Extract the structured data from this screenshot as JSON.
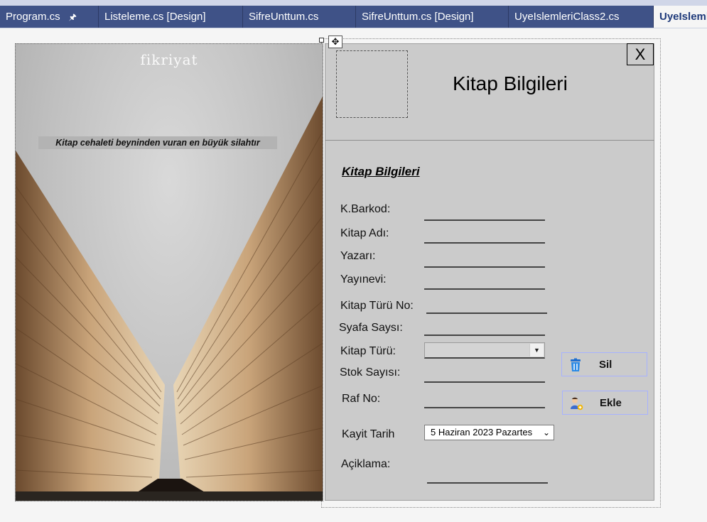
{
  "tabs": [
    {
      "label": "Program.cs",
      "pinned": true
    },
    {
      "label": "Listeleme.cs [Design]"
    },
    {
      "label": "SifreUnttum.cs"
    },
    {
      "label": "SifreUnttum.cs [Design]"
    },
    {
      "label": "UyeIslemleriClass2.cs"
    },
    {
      "label": "UyeIslemle",
      "active": true
    }
  ],
  "picture": {
    "brand": "fikriyat",
    "quote": "Kitap cehaleti beyninden vuran en büyük silahtır"
  },
  "form": {
    "title": "Kitap Bilgileri",
    "close_label": "X",
    "section_title": "Kitap Bilgileri",
    "labels": {
      "barkod": "K.Barkod:",
      "kitap_adi": "Kitap Adı:",
      "yazari": "Yazarı:",
      "yayinevi": "Yayınevi:",
      "kitap_turu_no": "Kitap Türü No:",
      "sayfa_sayisi": "Syafa Saysı:",
      "kitap_turu": "Kitap Türü:",
      "stok_sayisi": "Stok Sayısı:",
      "raf_no": "Raf No:",
      "kayit_tarih": "Kayit Tarih",
      "aciklama": "Açiklama:"
    },
    "kitap_turu_value": "",
    "kayit_tarih_value": "5  Haziran  2023  Pazartes",
    "buttons": {
      "sil": "Sil",
      "ekle": "Ekle"
    }
  },
  "colors": {
    "tab_bg": "#3f5287",
    "panel_bg": "#cbcbcb",
    "button_border": "#a7b2ff"
  }
}
